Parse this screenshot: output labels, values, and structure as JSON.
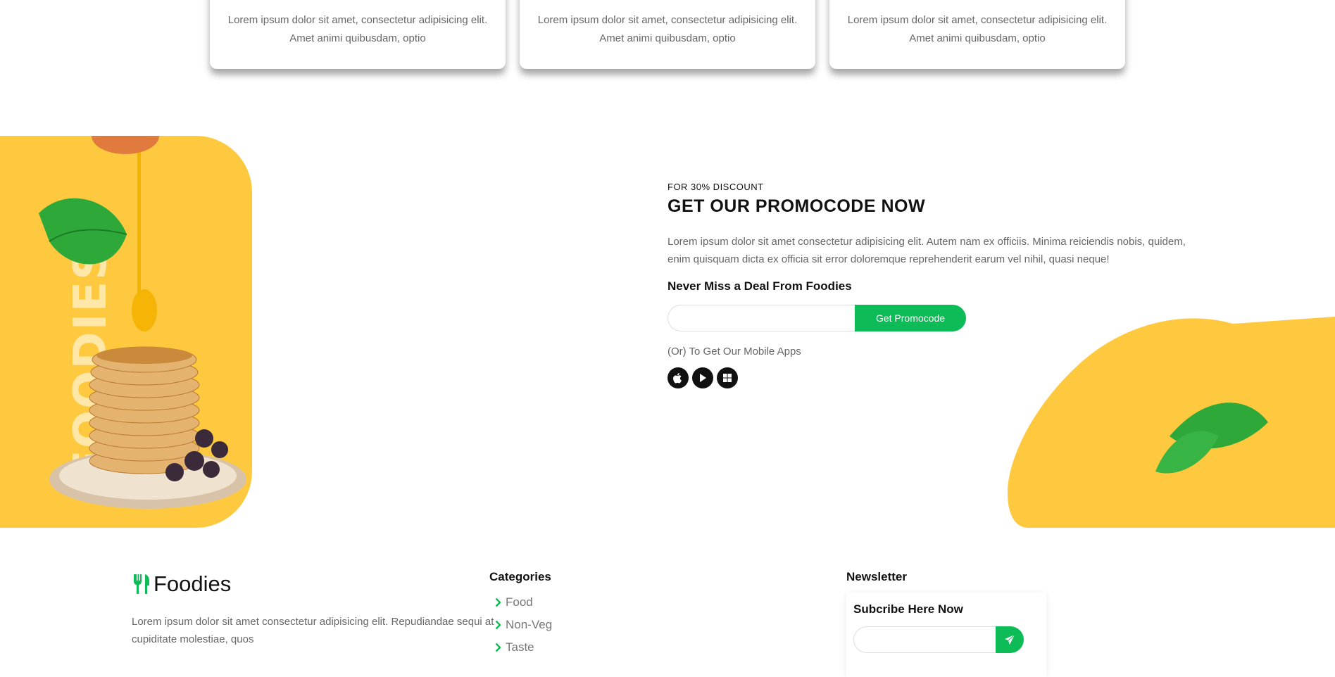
{
  "cards": [
    {
      "text": "Lorem ipsum dolor sit amet, consectetur adipisicing elit. Amet animi quibusdam, optio"
    },
    {
      "text": "Lorem ipsum dolor sit amet, consectetur adipisicing elit. Amet animi quibusdam, optio"
    },
    {
      "text": "Lorem ipsum dolor sit amet, consectetur adipisicing elit. Amet animi quibusdam, optio"
    }
  ],
  "promo": {
    "vertical_word": "FOODIES",
    "kicker": "FOR 30% DISCOUNT",
    "title": "GET OUR PROMOCODE NOW",
    "description": "Lorem ipsum dolor sit amet consectetur adipisicing elit. Autem nam ex officiis. Minima reiciendis nobis, quidem, enim quisquam dicta ex officia sit error doloremque reprehenderit earum vel nihil, quasi neque!",
    "deal_heading": "Never Miss a Deal From Foodies",
    "input_value": "",
    "button_label": "Get Promocode",
    "apps_text": "(Or) To Get Our Mobile Apps",
    "app_icons": [
      "apple-icon",
      "play-store-icon",
      "windows-icon"
    ]
  },
  "footer": {
    "brand_name": "Foodies",
    "brand_icon": "fork-knife-icon",
    "brand_description": "Lorem ipsum dolor sit amet consectetur adipisicing elit. Repudiandae sequi at cupiditate molestiae, quos",
    "categories_title": "Categories",
    "categories": [
      "Food",
      "Non-Veg",
      "Taste"
    ],
    "newsletter_title": "Newsletter",
    "newsletter_heading": "Subcribe Here Now",
    "newsletter_input_value": "",
    "newsletter_button_icon": "send-icon"
  },
  "colors": {
    "accent_green": "#0dbb57",
    "accent_yellow": "#ffc93f"
  }
}
